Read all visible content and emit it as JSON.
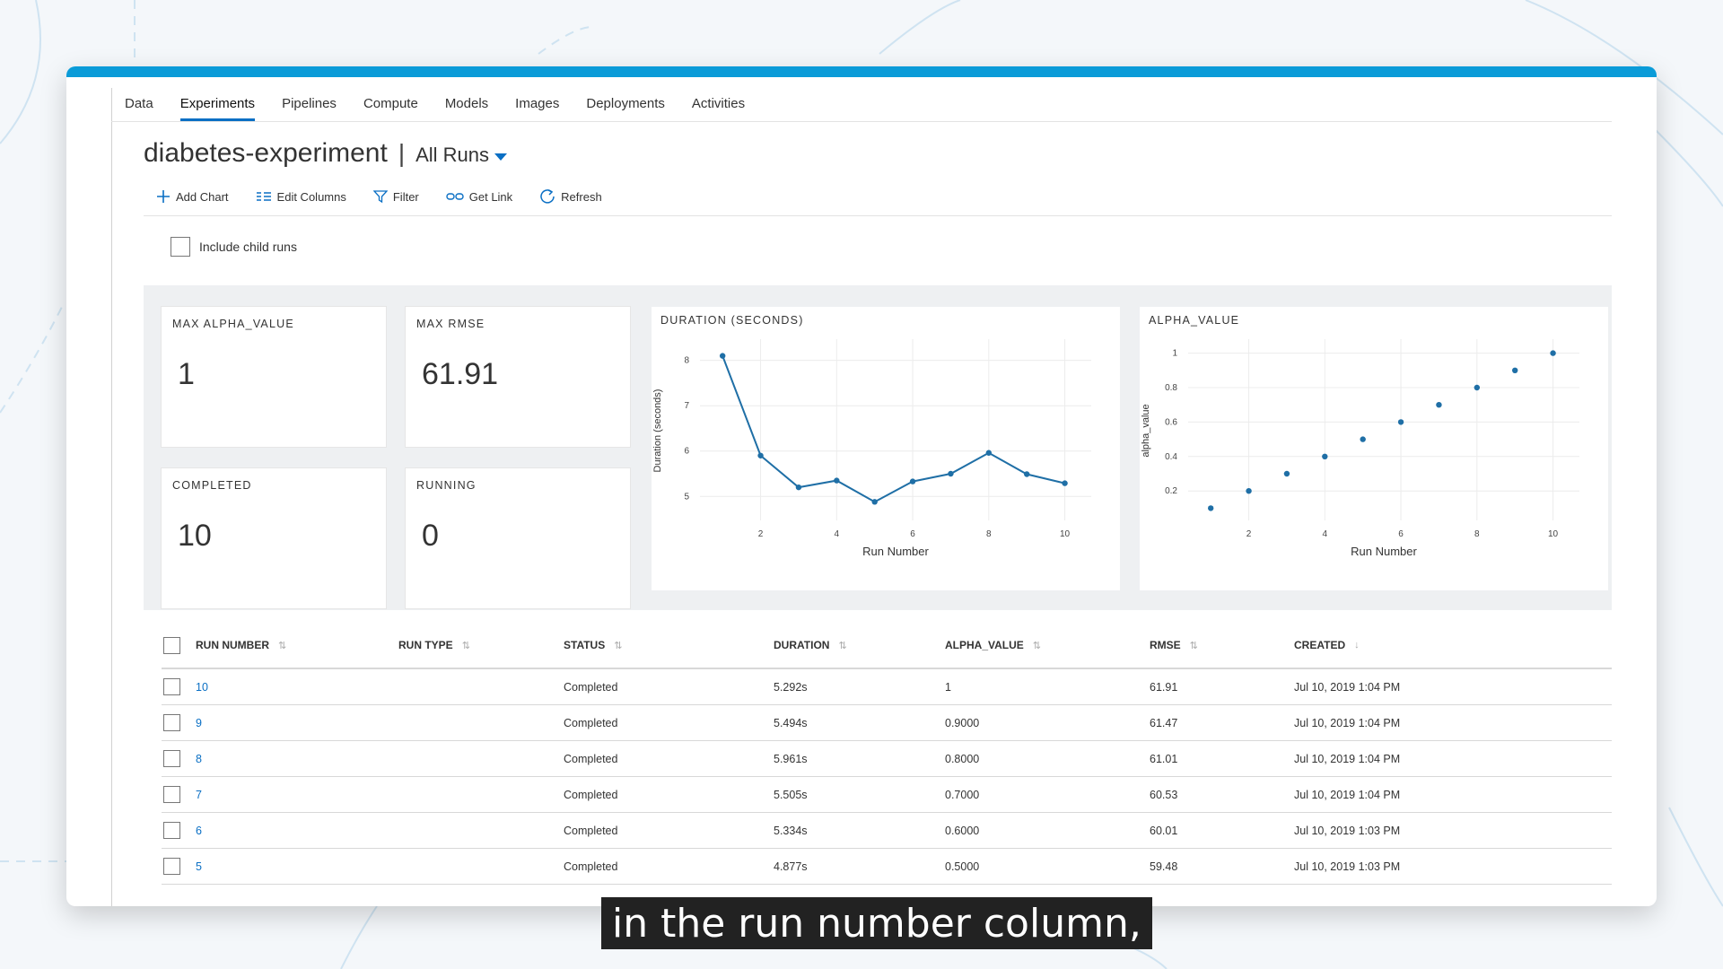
{
  "tabs": [
    {
      "label": "Data"
    },
    {
      "label": "Experiments",
      "active": true
    },
    {
      "label": "Pipelines"
    },
    {
      "label": "Compute"
    },
    {
      "label": "Models"
    },
    {
      "label": "Images"
    },
    {
      "label": "Deployments"
    },
    {
      "label": "Activities"
    }
  ],
  "header": {
    "title": "diabetes-experiment",
    "separator": "|",
    "runs_filter": "All Runs"
  },
  "toolbar": {
    "add_chart": "Add Chart",
    "edit_columns": "Edit Columns",
    "filter": "Filter",
    "get_link": "Get Link",
    "refresh": "Refresh"
  },
  "include_child_runs": {
    "label": "Include child runs",
    "checked": false
  },
  "metrics": {
    "max_alpha": {
      "label": "MAX ALPHA_VALUE",
      "value": "1"
    },
    "max_rmse": {
      "label": "MAX RMSE",
      "value": "61.91"
    },
    "completed": {
      "label": "COMPLETED",
      "value": "10"
    },
    "running": {
      "label": "RUNNING",
      "value": "0"
    }
  },
  "chart_data": [
    {
      "type": "line",
      "title": "DURATION (SECONDS)",
      "xlabel": "Run Number",
      "ylabel": "Duration (seconds)",
      "x": [
        1,
        2,
        3,
        4,
        5,
        6,
        7,
        8,
        9,
        10
      ],
      "y": [
        8.1,
        5.9,
        5.2,
        5.35,
        4.88,
        5.33,
        5.5,
        5.96,
        5.49,
        5.29
      ],
      "xticks": [
        2,
        4,
        6,
        8,
        10
      ],
      "yticks": [
        5,
        6,
        7,
        8
      ],
      "xlim": [
        0.5,
        10.6
      ],
      "ylim": [
        4.55,
        8.35
      ],
      "grid": true,
      "color": "#1f6fa6"
    },
    {
      "type": "scatter",
      "title": "ALPHA_VALUE",
      "xlabel": "Run Number",
      "ylabel": "alpha_value",
      "x": [
        1,
        2,
        3,
        4,
        5,
        6,
        7,
        8,
        9,
        10
      ],
      "y": [
        0.1,
        0.2,
        0.3,
        0.4,
        0.5,
        0.6,
        0.7,
        0.8,
        0.9,
        1.0
      ],
      "xticks": [
        2,
        4,
        6,
        8,
        10
      ],
      "yticks": [
        0.2,
        0.4,
        0.6,
        0.8,
        1
      ],
      "xlim": [
        0.5,
        10.6
      ],
      "ylim": [
        0.05,
        1.05
      ],
      "grid": true,
      "color": "#1f6fa6"
    }
  ],
  "table": {
    "columns": [
      "RUN NUMBER",
      "RUN TYPE",
      "STATUS",
      "DURATION",
      "ALPHA_VALUE",
      "RMSE",
      "CREATED"
    ],
    "rows": [
      {
        "run": "10",
        "type": "",
        "status": "Completed",
        "duration": "5.292s",
        "alpha": "1",
        "rmse": "61.91",
        "created": "Jul 10, 2019 1:04 PM"
      },
      {
        "run": "9",
        "type": "",
        "status": "Completed",
        "duration": "5.494s",
        "alpha": "0.9000",
        "rmse": "61.47",
        "created": "Jul 10, 2019 1:04 PM"
      },
      {
        "run": "8",
        "type": "",
        "status": "Completed",
        "duration": "5.961s",
        "alpha": "0.8000",
        "rmse": "61.01",
        "created": "Jul 10, 2019 1:04 PM"
      },
      {
        "run": "7",
        "type": "",
        "status": "Completed",
        "duration": "5.505s",
        "alpha": "0.7000",
        "rmse": "60.53",
        "created": "Jul 10, 2019 1:04 PM"
      },
      {
        "run": "6",
        "type": "",
        "status": "Completed",
        "duration": "5.334s",
        "alpha": "0.6000",
        "rmse": "60.01",
        "created": "Jul 10, 2019 1:03 PM"
      },
      {
        "run": "5",
        "type": "",
        "status": "Completed",
        "duration": "4.877s",
        "alpha": "0.5000",
        "rmse": "59.48",
        "created": "Jul 10, 2019 1:03 PM"
      }
    ]
  },
  "caption": "in the run number column,",
  "colors": {
    "accent": "#0a6fc4",
    "topbar": "#0a9bd8"
  }
}
